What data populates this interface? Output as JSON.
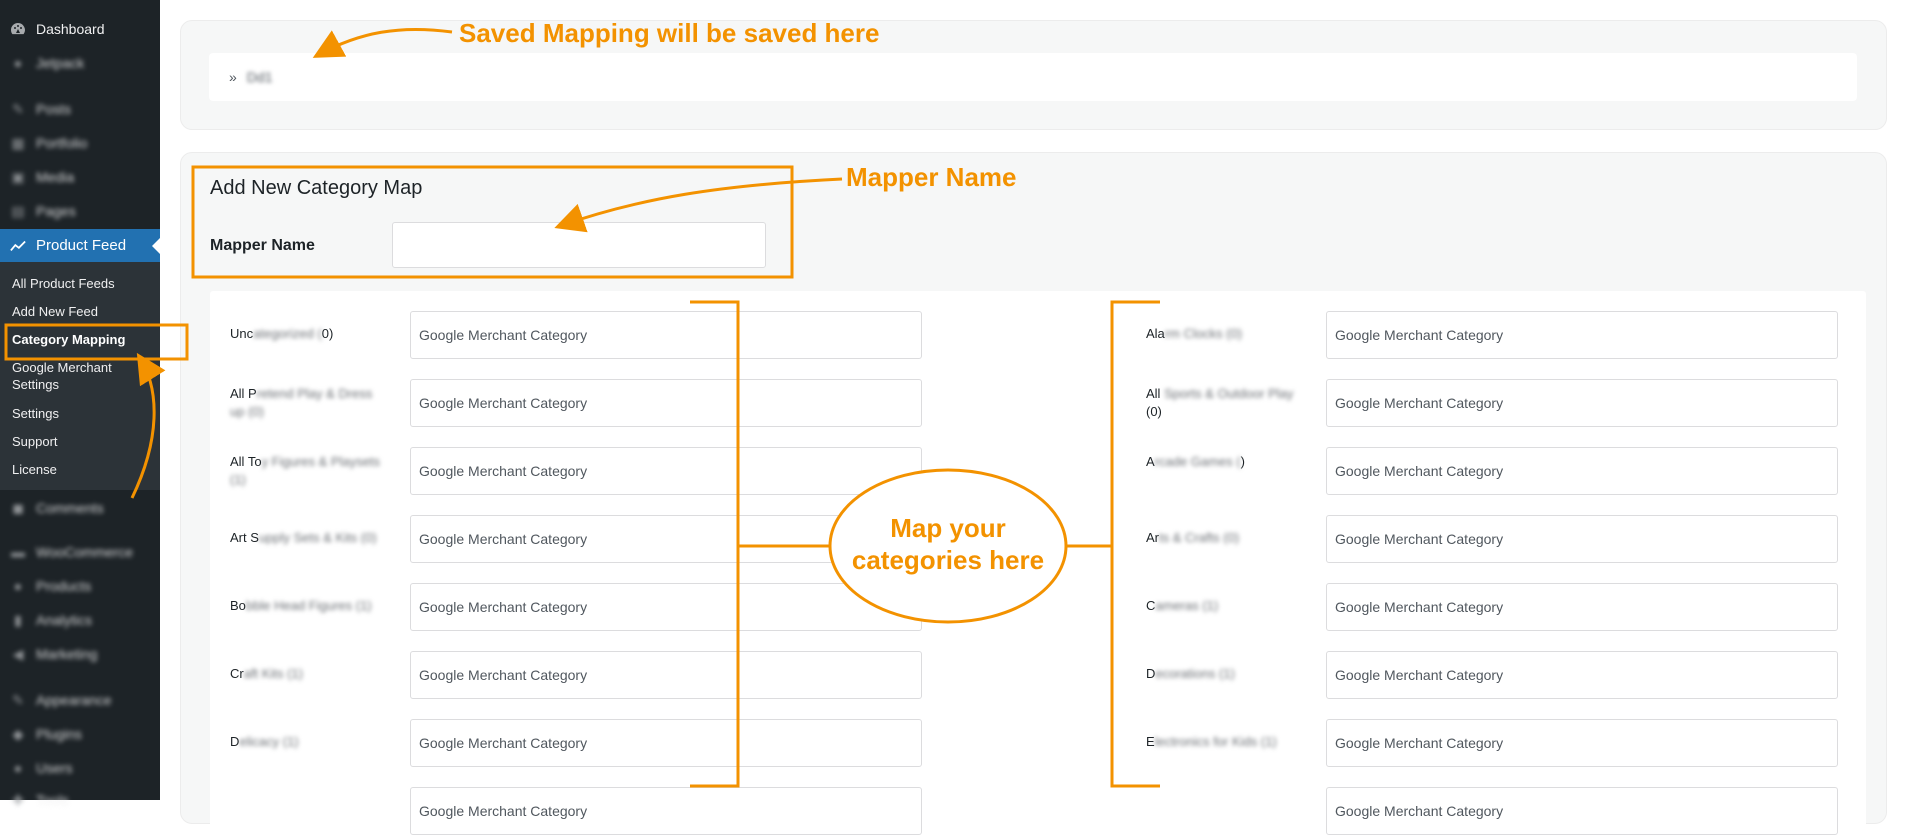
{
  "sidebar": {
    "top_items": [
      {
        "label": "Dashboard",
        "icon": "dashboard-icon"
      },
      {
        "label": "Jetpack",
        "icon": "jetpack-icon"
      },
      {
        "label": "Posts",
        "icon": "pin-icon"
      },
      {
        "label": "Portfolio",
        "icon": "portfolio-icon"
      },
      {
        "label": "Media",
        "icon": "media-icon"
      },
      {
        "label": "Pages",
        "icon": "pages-icon"
      }
    ],
    "active_item": {
      "label": "Product Feed",
      "icon": "chart-line-icon"
    },
    "submenu": [
      {
        "label": "All Product Feeds"
      },
      {
        "label": "Add New Feed"
      },
      {
        "label": "Category Mapping"
      },
      {
        "label": "Google Merchant Settings"
      },
      {
        "label": "Settings"
      },
      {
        "label": "Support"
      },
      {
        "label": "License"
      }
    ],
    "bottom_items": [
      {
        "label": "Comments",
        "icon": "comment-icon"
      },
      {
        "label": "WooCommerce",
        "icon": "woo-icon"
      },
      {
        "label": "Products",
        "icon": "products-icon"
      },
      {
        "label": "Analytics",
        "icon": "analytics-icon"
      },
      {
        "label": "Marketing",
        "icon": "megaphone-icon"
      },
      {
        "label": "Appearance",
        "icon": "brush-icon"
      },
      {
        "label": "Plugins",
        "icon": "plug-icon"
      },
      {
        "label": "Users",
        "icon": "user-icon"
      },
      {
        "label": "Tools",
        "icon": "wrench-icon"
      }
    ]
  },
  "saved": {
    "bullet": "»",
    "item": "Dd1"
  },
  "add_map": {
    "title": "Add New Category Map",
    "mapper_label": "Mapper Name",
    "mapper_value": ""
  },
  "categories": {
    "placeholder": "Google Merchant Category",
    "left": [
      {
        "visible": "Unc",
        "hidden": "ategorized (",
        "tail": "0)"
      },
      {
        "visible": "All P",
        "hidden": "retend Play & Dress up (0)",
        "tail": ""
      },
      {
        "visible": "All To",
        "hidden": "y Figures & Playsets (1)",
        "tail": ""
      },
      {
        "visible": "Art S",
        "hidden": "upply Sets & Kits (0)",
        "tail": ""
      },
      {
        "visible": "Bo",
        "hidden": "bble Head Figures (1)",
        "tail": ""
      },
      {
        "visible": "Cr",
        "hidden": "aft Kits (1)",
        "tail": ""
      },
      {
        "visible": "D",
        "hidden": "elicacy (1)",
        "tail": ""
      }
    ],
    "right": [
      {
        "visible": "Ala",
        "hidden": "rm Clocks (0)",
        "tail": ""
      },
      {
        "visible": "All",
        "hidden": " Sports & Outdoor Play",
        "tail": "(0)"
      },
      {
        "visible": "A",
        "hidden": "rcade Games (",
        "tail": ")"
      },
      {
        "visible": "Ar",
        "hidden": "ts & Crafts (0)",
        "tail": ""
      },
      {
        "visible": "C",
        "hidden": "ameras (1)",
        "tail": ""
      },
      {
        "visible": "D",
        "hidden": "ecorations (1)",
        "tail": ""
      },
      {
        "visible": "E",
        "hidden": "lectronics for Kids (1)",
        "tail": ""
      }
    ]
  },
  "annotations": {
    "saved": "Saved Mapping will be saved here",
    "mapper": "Mapper Name",
    "bubble_line1": "Map your",
    "bubble_line2": "categories here",
    "color": "#f39200"
  }
}
